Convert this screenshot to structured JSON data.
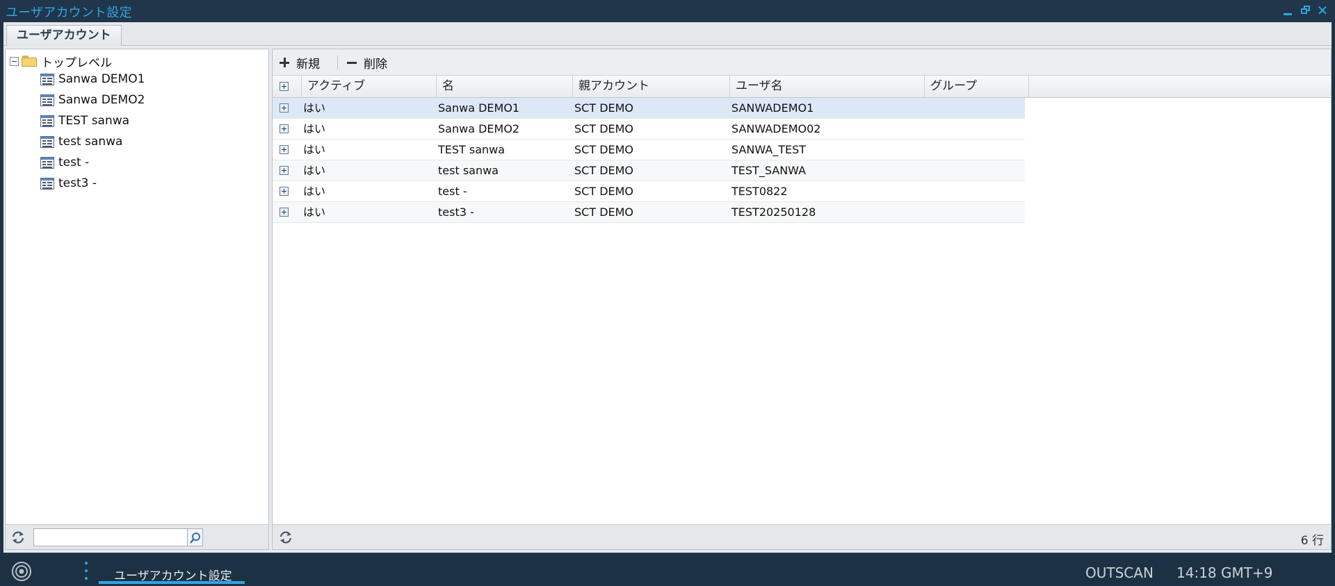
{
  "window": {
    "title": "ユーザアカウント設定",
    "controls": {
      "minimize": "minimize",
      "restore": "restore",
      "close": "✕"
    }
  },
  "tabs": [
    {
      "label": "ユーザアカウント",
      "active": true
    }
  ],
  "tree": {
    "root_label": "トップレベル",
    "items": [
      {
        "label": "Sanwa DEMO1"
      },
      {
        "label": "Sanwa DEMO2"
      },
      {
        "label": "TEST sanwa"
      },
      {
        "label": "test sanwa"
      },
      {
        "label": "test -"
      },
      {
        "label": "test3 -"
      }
    ],
    "search": {
      "value": "",
      "placeholder": ""
    }
  },
  "toolbar": {
    "new_label": "新規",
    "delete_label": "削除"
  },
  "grid": {
    "columns": [
      "アクティブ",
      "名",
      "親アカウント",
      "ユーザ名",
      "グループ"
    ],
    "rows": [
      {
        "active": "はい",
        "name": "Sanwa DEMO1",
        "parent": "SCT DEMO",
        "username": "SANWADEMO1",
        "group": ""
      },
      {
        "active": "はい",
        "name": "Sanwa DEMO2",
        "parent": "SCT DEMO",
        "username": "SANWADEMO02",
        "group": ""
      },
      {
        "active": "はい",
        "name": "TEST sanwa",
        "parent": "SCT DEMO",
        "username": "SANWA_TEST",
        "group": ""
      },
      {
        "active": "はい",
        "name": "test sanwa",
        "parent": "SCT DEMO",
        "username": "TEST_SANWA",
        "group": ""
      },
      {
        "active": "はい",
        "name": "test -",
        "parent": "SCT DEMO",
        "username": "TEST0822",
        "group": ""
      },
      {
        "active": "はい",
        "name": "test3 -",
        "parent": "SCT DEMO",
        "username": "TEST20250128",
        "group": ""
      }
    ],
    "row_count": "6 行"
  },
  "taskbar": {
    "task_label": "ユーザアカウント設定",
    "status": "OUTSCAN",
    "clock": "14:18 GMT+9"
  },
  "colors": {
    "accent": "#2fa6e6",
    "titlebar": "#21364a",
    "selected_row": "#dde8f6"
  }
}
